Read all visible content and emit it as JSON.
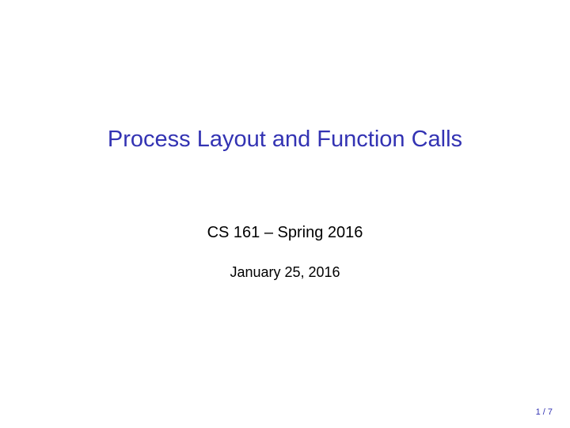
{
  "slide": {
    "title": "Process Layout and Function Calls",
    "subtitle": "CS 161 – Spring 2016",
    "date": "January 25, 2016",
    "page_number": "1 / 7"
  }
}
